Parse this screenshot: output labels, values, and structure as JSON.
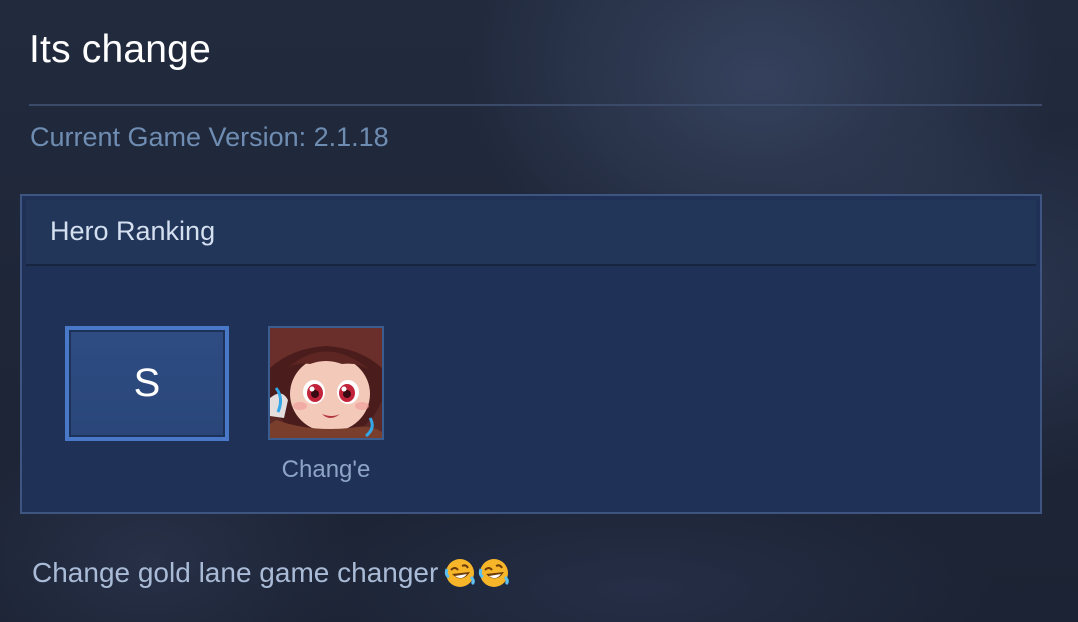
{
  "post": {
    "title": "Its change",
    "version_text": "Current Game Version: 2.1.18",
    "comment": "Change gold lane game changer",
    "comment_emojis": [
      "rolling-on-floor-laughing",
      "rolling-on-floor-laughing"
    ]
  },
  "ranking": {
    "header": "Hero Ranking",
    "tier": "S",
    "heroes": [
      {
        "name": "Chang'e",
        "icon": "hero-portrait"
      }
    ]
  },
  "colors": {
    "background": "#1e2638",
    "panel": "#1f3157",
    "tier_border": "#4a78c9",
    "version_text": "#6f8db2"
  }
}
